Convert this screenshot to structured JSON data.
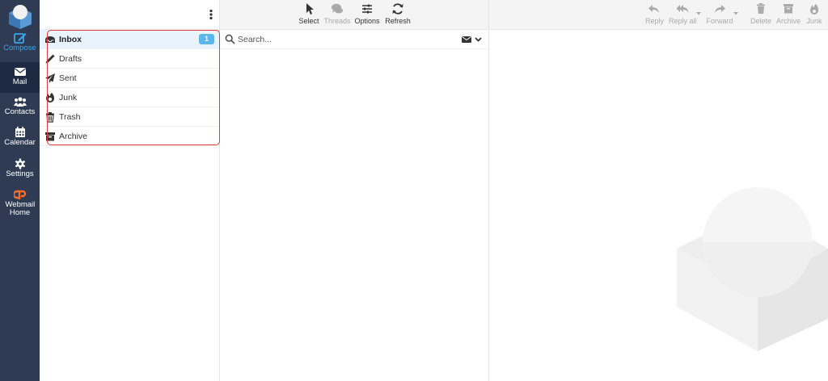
{
  "nav": {
    "items": [
      {
        "label": "Compose",
        "icon": "compose-icon"
      },
      {
        "label": "Mail",
        "icon": "mail-icon"
      },
      {
        "label": "Contacts",
        "icon": "contacts-icon"
      },
      {
        "label": "Calendar",
        "icon": "calendar-icon"
      },
      {
        "label": "Settings",
        "icon": "gear-icon"
      },
      {
        "label": "Webmail Home",
        "icon": "cpanel-icon"
      }
    ]
  },
  "folders": [
    {
      "name": "Inbox",
      "icon": "inbox-icon",
      "unread": "1"
    },
    {
      "name": "Drafts",
      "icon": "pencil-icon"
    },
    {
      "name": "Sent",
      "icon": "paper-plane-icon"
    },
    {
      "name": "Junk",
      "icon": "fire-icon"
    },
    {
      "name": "Trash",
      "icon": "trash-icon"
    },
    {
      "name": "Archive",
      "icon": "archive-icon"
    }
  ],
  "list_toolbar": {
    "select": "Select",
    "threads": "Threads",
    "options": "Options",
    "refresh": "Refresh"
  },
  "search": {
    "placeholder": "Search..."
  },
  "preview_toolbar": {
    "reply": "Reply",
    "reply_all": "Reply all",
    "forward": "Forward",
    "delete": "Delete",
    "archive": "Archive",
    "junk": "Junk"
  },
  "colors": {
    "nav_bg": "#2f3b53",
    "accent": "#3ba6ea",
    "badge": "#5bb7ea",
    "highlight_border": "#e23b3b"
  }
}
